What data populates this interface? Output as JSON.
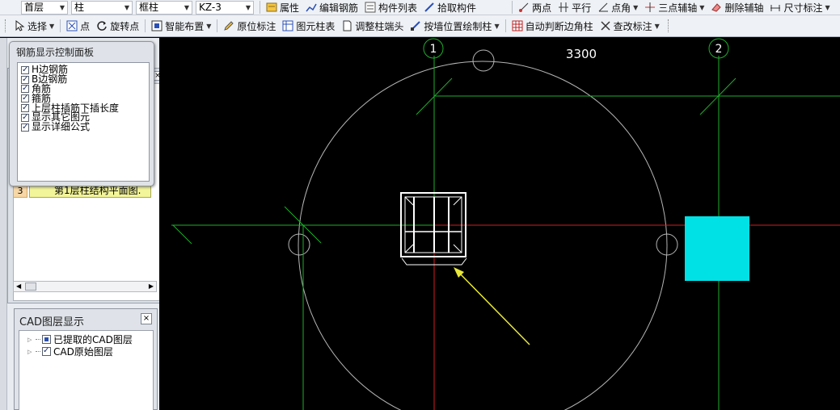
{
  "toolbar_top": {
    "floor": "首层",
    "element_type": "柱",
    "element_sub": "框柱",
    "element_name": "KZ-3",
    "property": "属性",
    "edit_rebar": "编辑钢筋",
    "component_list": "构件列表",
    "pick_component": "拾取构件",
    "two_points": "两点",
    "parallel": "平行",
    "point_angle": "点角",
    "three_point_axis": "三点辅轴",
    "delete_axis": "删除辅轴",
    "dimension": "尺寸标注"
  },
  "toolbar_main": {
    "select": "选择",
    "point": "点",
    "rotate_point": "旋转点",
    "smart_layout": "智能布置",
    "in_place_label": "原位标注",
    "element_table": "图元柱表",
    "adjust_column_end": "调整柱端头",
    "draw_by_wall": "按墙位置绘制柱",
    "auto_edge_column": "自动判断边角柱",
    "check_label": "查改标注"
  },
  "rebar_panel": {
    "title": "钢筋显示控制面板",
    "items": [
      "H边钢筋",
      "B边钢筋",
      "角筋",
      "箍筋",
      "上层柱插筋下插长度",
      "显示其它图元",
      "显示详细公式"
    ]
  },
  "back_panel": {
    "row_num": "3",
    "row_text": "第1层柱结构平面图."
  },
  "cad_panel": {
    "title": "CAD图层显示",
    "close": "×",
    "layers": [
      "已提取的CAD图层",
      "CAD原始图层"
    ]
  },
  "canvas": {
    "axis_1": "1",
    "axis_2": "2",
    "dimension": "3300"
  },
  "colors": {
    "canvas_bg": "#000000",
    "axis_green": "#1fae2b",
    "axis_red": "#d21b1b",
    "column_cyan": "#00e1e6",
    "arrow_yellow": "#e8e83a"
  }
}
